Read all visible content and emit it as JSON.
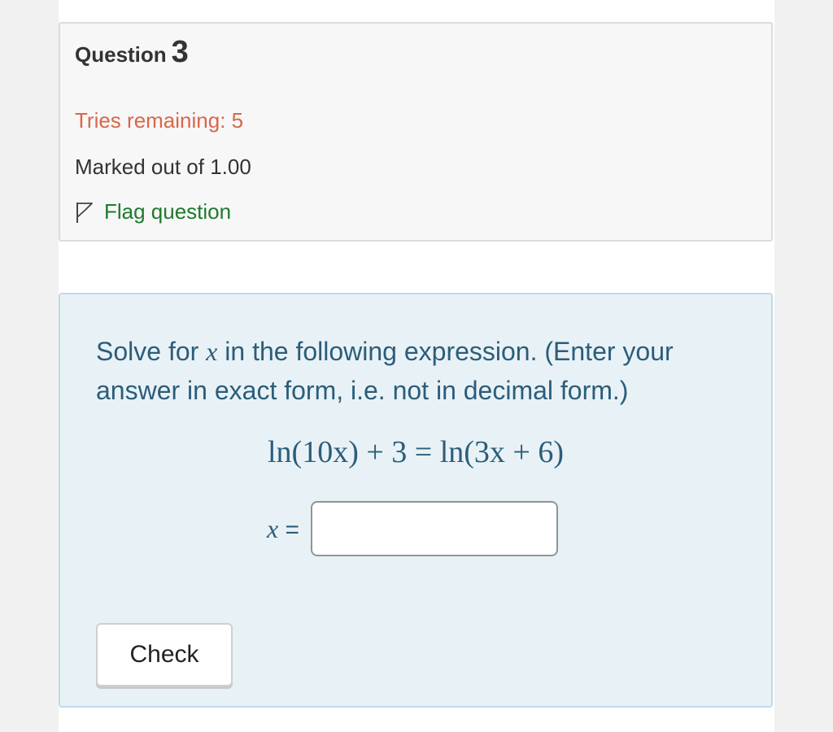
{
  "question_info": {
    "question_word": "Question",
    "question_number": "3",
    "tries_remaining": "Tries remaining: 5",
    "marked_out_of": "Marked out of 1.00",
    "flag_label": "Flag question"
  },
  "question_text": {
    "prompt_before_var": "Solve for ",
    "variable": "x",
    "prompt_after_var": " in the following expression. (Enter your answer in exact form, i.e. not in decimal form.)",
    "equation": "ln(10x) + 3 = ln(3x + 6)",
    "answer_variable": "x",
    "answer_equals": "=",
    "answer_value": "",
    "check_label": "Check"
  },
  "colors": {
    "tries": "#d9664b",
    "flag": "#1f7a2e",
    "question_text": "#2c5d7a",
    "question_background": "#e8f2f6"
  }
}
